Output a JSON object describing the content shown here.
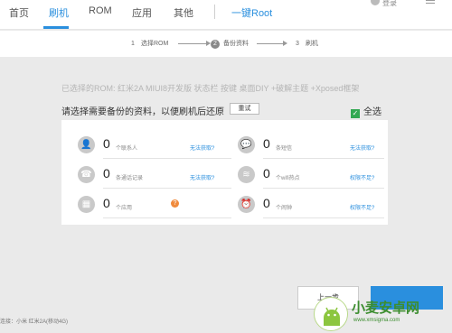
{
  "nav": {
    "items": [
      "首页",
      "刷机",
      "ROM",
      "应用",
      "其他"
    ],
    "one_click_root": "一键Root",
    "login": "登录"
  },
  "stepper": {
    "steps": [
      {
        "num": "1",
        "label": "选择ROM"
      },
      {
        "num": "2",
        "label": "备份资料"
      },
      {
        "num": "3",
        "label": "刷机"
      }
    ],
    "current_step": 2
  },
  "main": {
    "selected_rom": "已选择的ROM:  红米2A MIUI8开发版 状态栏 按键 桌面DIY +破解主题 +Xposed框架",
    "prompt": "请选择需要备份的资料，以便刷机后还原",
    "reset_label": "重试",
    "select_all": "全选"
  },
  "backup_items": [
    {
      "icon": "contact-icon",
      "count": "0",
      "label": "个联系人",
      "link": "无法获取?"
    },
    {
      "icon": "message-icon",
      "count": "0",
      "label": "条短信",
      "link": "无法获取?"
    },
    {
      "icon": "phone-icon",
      "count": "0",
      "label": "条通话记录",
      "link": "无法获取?"
    },
    {
      "icon": "wifi-icon",
      "count": "0",
      "label": "个wifi热点",
      "link": "权限不足?"
    },
    {
      "icon": "apps-icon",
      "count": "0",
      "label": "个应用",
      "link": ""
    },
    {
      "icon": "alarm-icon",
      "count": "0",
      "label": "个闹钟",
      "link": "权限不足?"
    }
  ],
  "buttons": {
    "prev": "上一步"
  },
  "status": "连接：小米 红米2A(移动4G)",
  "watermark": {
    "title": "小麦安卓网",
    "url": "www.xmsigma.com"
  },
  "colors": {
    "accent": "#2a8fde",
    "check_green": "#33a852",
    "warning": "#f08a3c"
  }
}
